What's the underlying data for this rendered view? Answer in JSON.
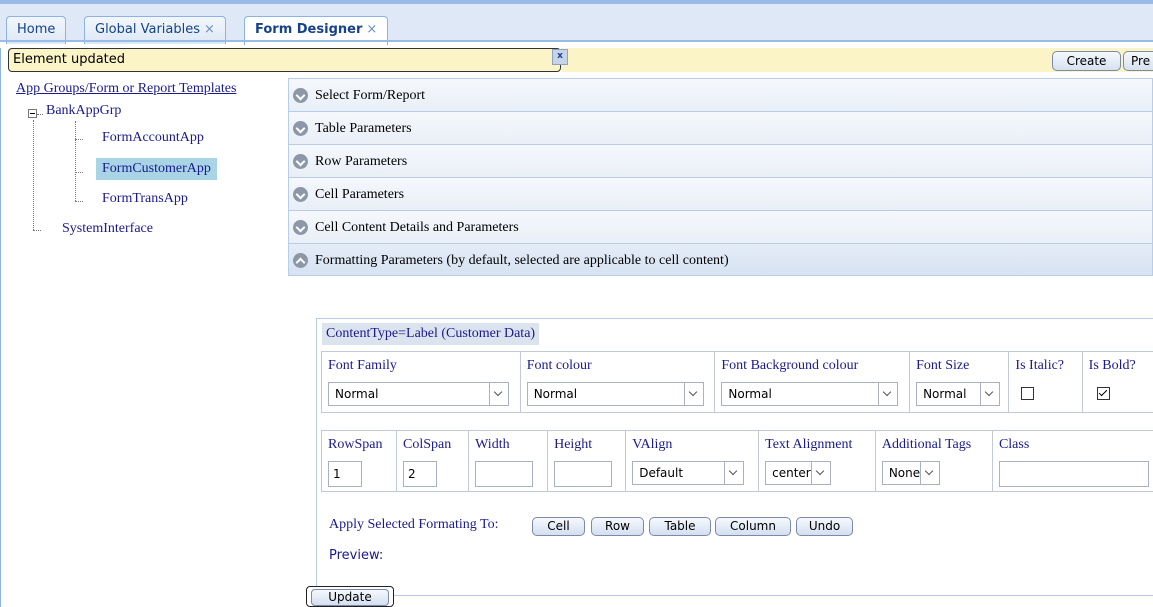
{
  "tabs": [
    {
      "label": "Home",
      "closable": false
    },
    {
      "label": "Global Variables",
      "closable": true
    },
    {
      "label": "Form Designer",
      "closable": true,
      "active": true
    }
  ],
  "tab_close_glyph": "×",
  "status": {
    "message": "Element updated",
    "close_label": "x"
  },
  "toolbar": {
    "create_label": "Create",
    "preview_label": "Pre"
  },
  "tree": {
    "root_label": "App Groups/Form or Report Templates",
    "group_label": "BankAppGrp",
    "children": [
      "FormAccountApp",
      "FormCustomerApp",
      "FormTransApp"
    ],
    "selected": "FormCustomerApp",
    "sibling_label": "SystemInterface"
  },
  "accordion": [
    "Select Form/Report",
    "Table Parameters",
    "Row Parameters",
    "Cell Parameters",
    "Cell Content Details and Parameters",
    "Formatting Parameters (by default, selected are applicable to cell content)"
  ],
  "formatting": {
    "content_type": "ContentType=Label (Customer Data)",
    "row1": {
      "font_family_label": "Font Family",
      "font_family_value": "Normal",
      "font_colour_label": "Font colour",
      "font_colour_value": "Normal",
      "font_bg_label": "Font Background colour",
      "font_bg_value": "Normal",
      "font_size_label": "Font Size",
      "font_size_value": "Normal",
      "italic_label": "Is Italic?",
      "italic_checked": false,
      "bold_label": "Is Bold?",
      "bold_checked": true
    },
    "row2": {
      "rowspan_label": "RowSpan",
      "rowspan_value": "1",
      "colspan_label": "ColSpan",
      "colspan_value": "2",
      "width_label": "Width",
      "width_value": "",
      "height_label": "Height",
      "height_value": "",
      "valign_label": "VAlign",
      "valign_value": "Default",
      "text_align_label": "Text Alignment",
      "text_align_value": "center",
      "additional_tags_label": "Additional Tags",
      "additional_tags_value": "None",
      "class_label": "Class",
      "class_value": ""
    },
    "apply_label": "Apply Selected Formating To:",
    "apply_buttons": [
      "Cell",
      "Row",
      "Table",
      "Column",
      "Undo"
    ],
    "preview_label": "Preview:"
  },
  "update_label": "Update",
  "icons": [
    "close-icon",
    "expand-icon",
    "collapse-icon",
    "dropdown-icon",
    "checkbox-icon"
  ]
}
